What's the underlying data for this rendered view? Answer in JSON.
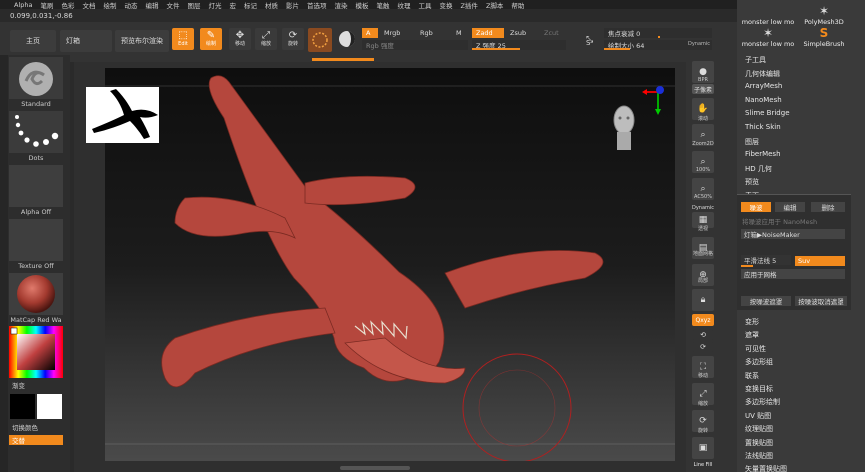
{
  "menu": [
    "Alpha",
    "笔刷",
    "色彩",
    "文档",
    "绘制",
    "动态",
    "编辑",
    "文件",
    "图层",
    "灯光",
    "宏",
    "标记",
    "材质",
    "影片",
    "首选项",
    "渲染",
    "模板",
    "笔触",
    "纹理",
    "工具",
    "变换",
    "Z插件",
    "Z脚本",
    "帮助"
  ],
  "coords": "0.099,0.031,-0.86",
  "topbar": {
    "main_label": "主页",
    "lightbox_label": "灯箱",
    "bpr_label": "预览布尔渲染",
    "edit_label": "Edit",
    "draw_label": "绘制",
    "move_label": "移动",
    "scale_label": "缩放",
    "rotate_label": "旋转",
    "a_label": "A",
    "mrgb_label": "Mrgb",
    "rgb_label": "Rgb",
    "m_label": "M",
    "rgb_intensity_label": "Rgb 强度",
    "zadd_label": "Zadd",
    "zsub_label": "Zsub",
    "zcut_label": "Zcut",
    "z_intensity_label": "Z 强度 25",
    "s_label": "S",
    "focal_shift_label": "焦点衰减 0",
    "draw_size_label": "绘制大小 64",
    "dynamic_label": "Dynamic"
  },
  "left": {
    "standard": "Standard",
    "dots": "Dots",
    "alpha_off": "Alpha Off",
    "texture_off": "Texture Off",
    "matcap": "MatCap Red Wa",
    "gradient": "渐变",
    "switch_color": "切换颜色",
    "alternate": "交替"
  },
  "colors": {
    "accent": "#f28a1d",
    "clay": "#b5473d"
  },
  "right_shelf": {
    "bpr": "BPR",
    "subpixel": "子像素",
    "scroll": "滚动",
    "zoom2d": "Zoom2D",
    "percent100": "100%",
    "ac50": "AC50%",
    "dynamic": "Dynamic",
    "persp": "透视",
    "floor": "地面网格",
    "local": "局部",
    "xyz": "Qxyz",
    "move": "移动",
    "scale": "缩放",
    "rotate": "旋转",
    "linefill": "Line Fill"
  },
  "brushes": {
    "top_left": "monster low mo",
    "top_right": "PolyMesh3D",
    "bottom_left": "monster low mo",
    "bottom_right": "SimpleBrush"
  },
  "right_panel": {
    "items_top": [
      "子工具",
      "几何体编辑",
      "ArrayMesh",
      "NanoMesh",
      "Slime Bridge",
      "Thick Skin",
      "图层",
      "FiberMesh",
      "HD 几何",
      "预览",
      "表面"
    ],
    "noise_btn": "噪波",
    "edit_btn": "编辑",
    "delete_btn": "删除",
    "noise_to_nano": "将噪波应用于 NanoMesh",
    "noisemaker": "灯箱▶NoiseMaker",
    "smooth_normal": "平滑法线 5",
    "suv": "Suv",
    "apply_mesh": "应用于网格",
    "mask_by_noise": "按噪波遮罩",
    "unmask_by_noise": "按噪波取消遮罩",
    "items_bottom": [
      "变形",
      "遮罩",
      "可见性",
      "多边形组",
      "联系",
      "变换目标",
      "多边形绘制",
      "UV 贴图",
      "纹理贴图",
      "置换贴图",
      "法线贴图",
      "矢量置换贴图"
    ]
  }
}
